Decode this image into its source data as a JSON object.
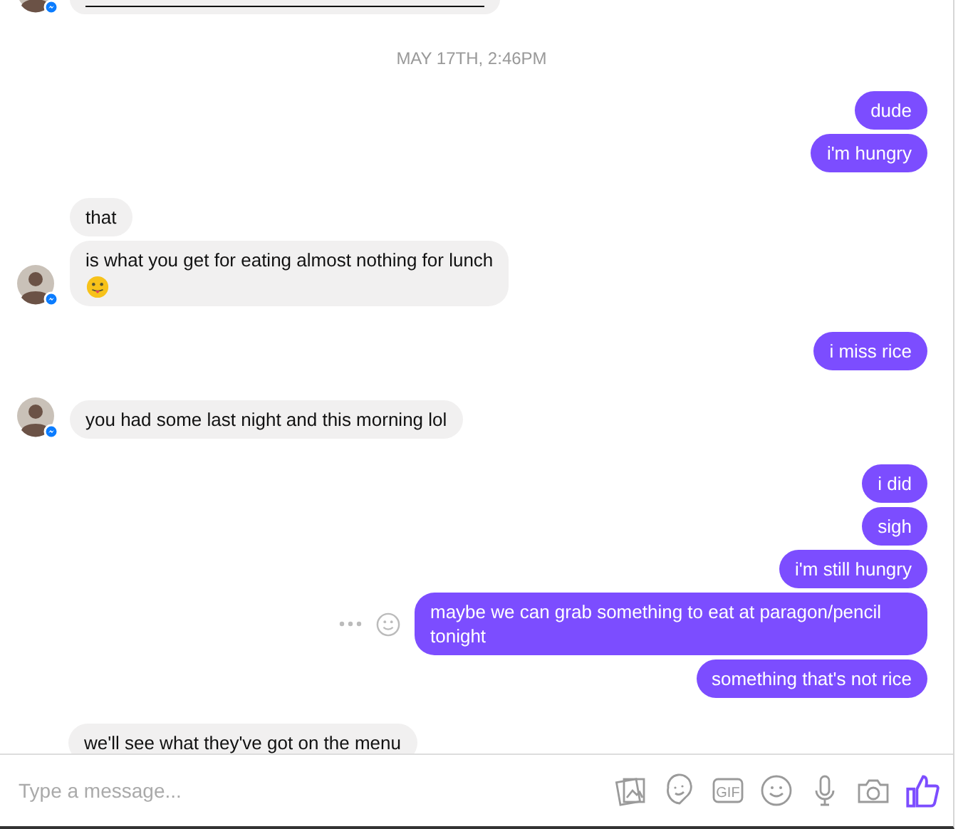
{
  "thread": [
    {
      "kind": "incoming",
      "avatar": true,
      "messages": [
        {
          "kind": "link"
        }
      ]
    },
    {
      "kind": "timestamp",
      "text": "MAY 17TH, 2:46PM"
    },
    {
      "kind": "outgoing",
      "avatar": false,
      "messages": [
        {
          "kind": "text",
          "text": "dude"
        },
        {
          "kind": "text",
          "text": "i'm hungry"
        }
      ]
    },
    {
      "kind": "incoming",
      "avatar": true,
      "messages": [
        {
          "kind": "text",
          "text": "that"
        },
        {
          "kind": "text",
          "text": "is what you get for eating almost nothing for lunch",
          "sticker": true
        }
      ]
    },
    {
      "kind": "outgoing",
      "avatar": false,
      "messages": [
        {
          "kind": "text",
          "text": "i miss rice"
        }
      ]
    },
    {
      "kind": "incoming",
      "avatar": true,
      "messages": [
        {
          "kind": "text",
          "text": "you had some last night and this morning lol"
        }
      ]
    },
    {
      "kind": "outgoing",
      "avatar": false,
      "messages": [
        {
          "kind": "text",
          "text": "i did"
        },
        {
          "kind": "text",
          "text": "sigh"
        },
        {
          "kind": "text",
          "text": "i'm still hungry"
        },
        {
          "kind": "text",
          "text": "maybe we can grab something to eat at paragon/pencil tonight",
          "hover": true
        },
        {
          "kind": "text",
          "text": "something that's not rice"
        }
      ]
    },
    {
      "kind": "incoming",
      "avatar": false,
      "messages": [
        {
          "kind": "text",
          "text": "we'll see what they've got on the menu"
        }
      ]
    }
  ],
  "composer": {
    "placeholder": "Type a message...",
    "gif_label": "GIF"
  }
}
